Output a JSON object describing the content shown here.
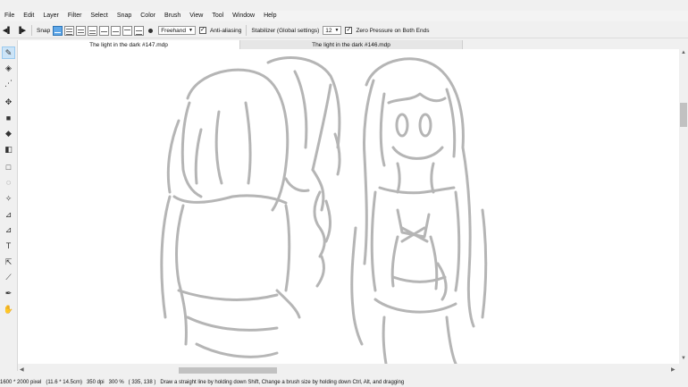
{
  "menu": [
    "File",
    "Edit",
    "Layer",
    "Filter",
    "Select",
    "Snap",
    "Color",
    "Brush",
    "View",
    "Tool",
    "Window",
    "Help"
  ],
  "toolbar": {
    "prev_icon": "◀▌",
    "next_icon": "▐▶",
    "snap_label": "Snap",
    "brush_mode": "Freehand",
    "antialias_label": "Anti-aliasing",
    "stabilizer_label": "Stabilizer (Global settings)",
    "stabilizer_value": "12",
    "zero_pressure_label": "Zero Pressure on Both Ends"
  },
  "tabs": [
    {
      "label": "The light in the dark #147.mdp",
      "active": true
    },
    {
      "label": "The light in the dark #146.mdp",
      "active": false
    }
  ],
  "tools": [
    {
      "name": "pen-tool",
      "glyph": "✎",
      "active": true
    },
    {
      "name": "eraser-tool",
      "glyph": "◈"
    },
    {
      "name": "dot-tool",
      "glyph": "⋰"
    },
    {
      "name": "move-tool",
      "glyph": "✥"
    },
    {
      "name": "fill-rect-tool",
      "glyph": "■"
    },
    {
      "name": "bucket-tool",
      "glyph": "◆"
    },
    {
      "name": "gradient-tool",
      "glyph": "◧"
    },
    {
      "name": "select-tool",
      "glyph": "□"
    },
    {
      "name": "lasso-tool",
      "glyph": "◌"
    },
    {
      "name": "magic-wand-tool",
      "glyph": "✧"
    },
    {
      "name": "select-pen-tool",
      "glyph": "⊿"
    },
    {
      "name": "select-eraser-tool",
      "glyph": "⊿"
    },
    {
      "name": "text-tool",
      "glyph": "T"
    },
    {
      "name": "operation-tool",
      "glyph": "⇱"
    },
    {
      "name": "divide-tool",
      "glyph": "⟋"
    },
    {
      "name": "eyedropper-tool",
      "glyph": "✒"
    },
    {
      "name": "hand-tool",
      "glyph": "✋"
    }
  ],
  "status": {
    "size": "1600 * 2000 pixel",
    "cm": "(11.6 * 14.5cm)",
    "dpi": "350 dpi",
    "zoom": "300 %",
    "coords": "( 335, 138 )",
    "hint": "Draw a straight line by holding down Shift, Change a brush size by holding down Ctrl, Alt, and dragging"
  }
}
